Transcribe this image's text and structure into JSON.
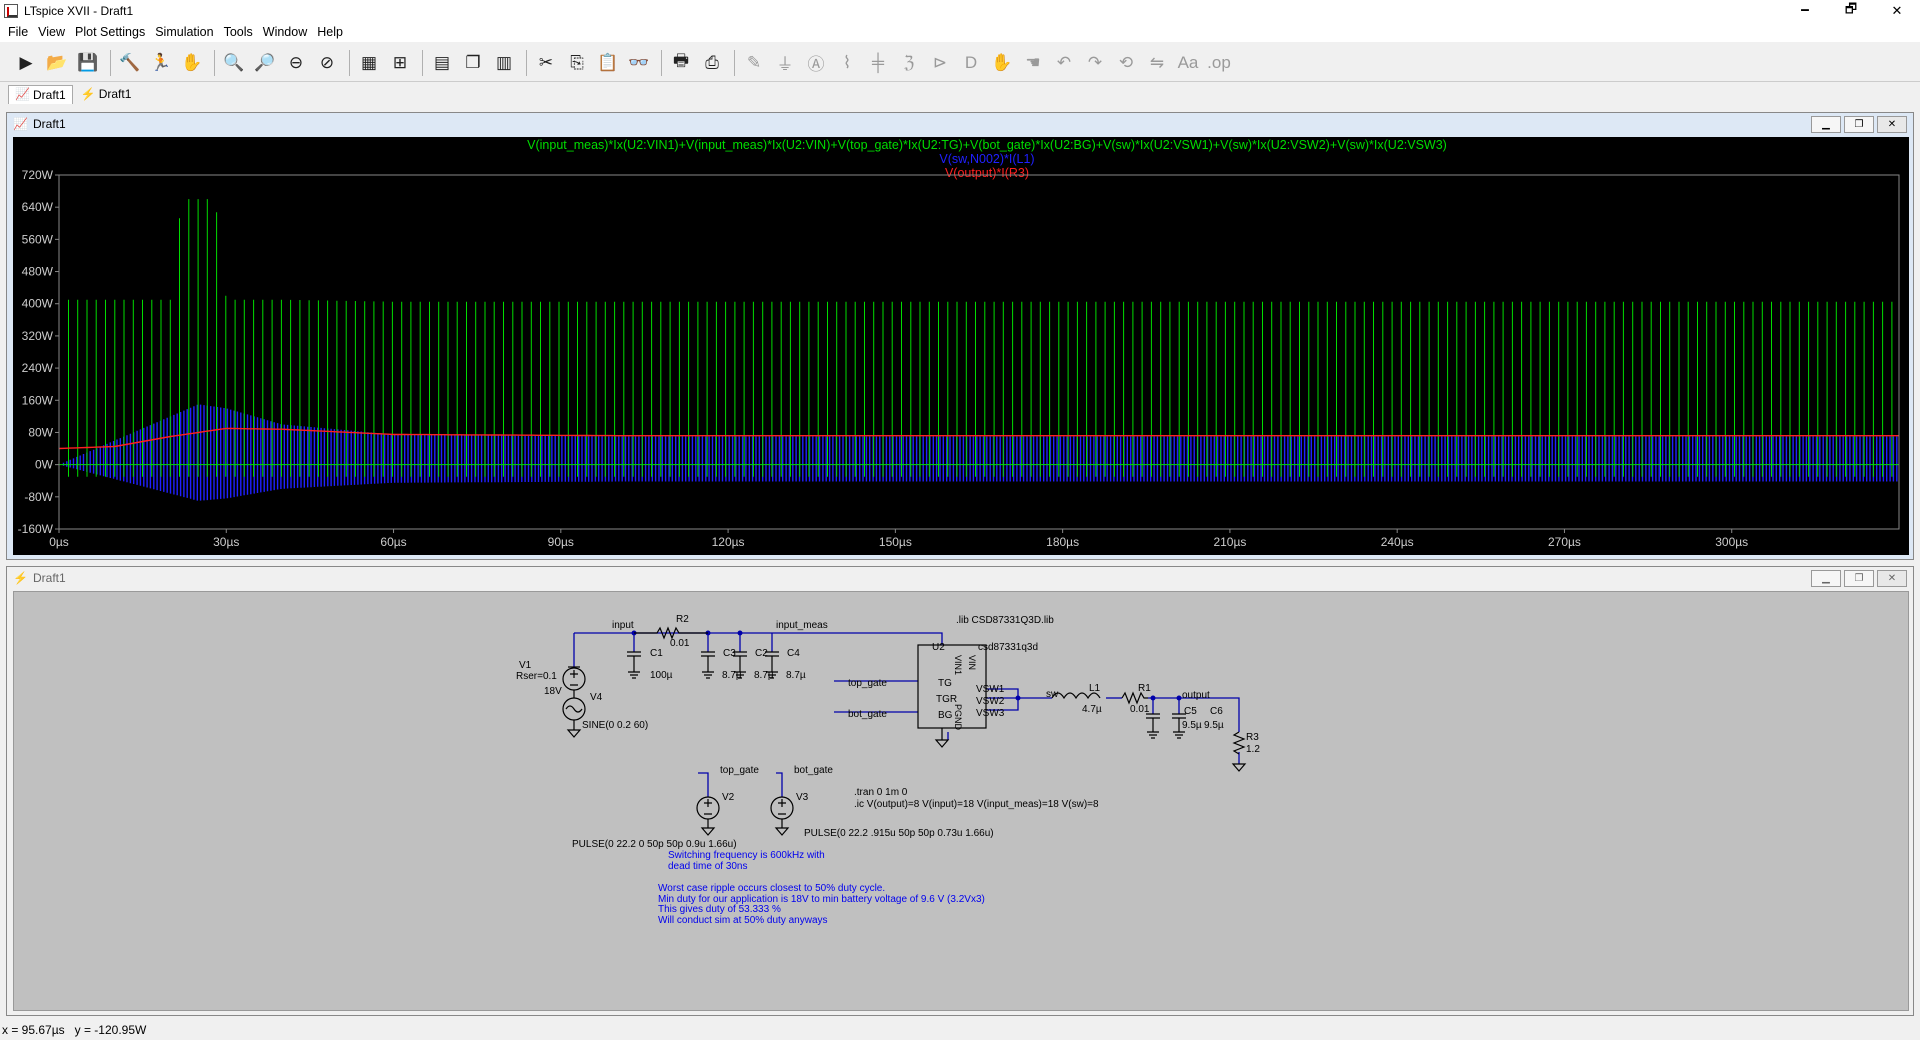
{
  "window": {
    "title": "LTspice XVII - Draft1",
    "min": "🗕",
    "max": "🗗",
    "close": "✕"
  },
  "menu": [
    "File",
    "View",
    "Plot Settings",
    "Simulation",
    "Tools",
    "Window",
    "Help"
  ],
  "toolbar": {
    "icons": [
      "open-schematic-icon",
      "open-file-icon",
      "save-icon",
      "control-panel-icon",
      "run-icon",
      "halt-icon",
      "zoom-in-icon",
      "zoom-out-icon",
      "zoom-fit-icon",
      "zoom-cancel-icon",
      "autorange-icon",
      "mark-icon",
      "tile-horizontal-icon",
      "cascade-icon",
      "tile-vertical-icon",
      "cut-icon",
      "copy-icon",
      "paste-icon",
      "find-icon",
      "print-icon",
      "print-setup-icon",
      "wire-icon",
      "ground-icon",
      "label-icon",
      "resistor-icon",
      "capacitor-icon",
      "inductor-icon",
      "diode-icon",
      "component-icon",
      "move-icon",
      "drag-icon",
      "undo-icon",
      "redo-icon",
      "rotate-icon",
      "mirror-icon",
      "text-icon",
      "spice-directive-icon"
    ]
  },
  "tabs": [
    {
      "label": "Draft1",
      "icon": "waveform-icon"
    },
    {
      "label": "Draft1",
      "icon": "schematic-icon"
    }
  ],
  "plot_window": {
    "title": "Draft1"
  },
  "schematic_window": {
    "title": "Draft1"
  },
  "plot": {
    "traces": [
      {
        "label": "V(input_meas)*Ix(U2:VIN1)+V(input_meas)*Ix(U2:VIN)+V(top_gate)*Ix(U2:TG)+V(bot_gate)*Ix(U2:BG)+V(sw)*Ix(U2:VSW1)+V(sw)*Ix(U2:VSW2)+V(sw)*Ix(U2:VSW3)",
        "color": "#00dd00"
      },
      {
        "label": "V(sw,N002)*I(L1)",
        "color": "#2020ff"
      },
      {
        "label": "V(output)*I(R3)",
        "color": "#ff2020"
      }
    ],
    "y_ticks": [
      "720W",
      "640W",
      "560W",
      "480W",
      "400W",
      "320W",
      "240W",
      "160W",
      "80W",
      "0W",
      "-80W",
      "-160W"
    ],
    "x_ticks": [
      "0µs",
      "30µs",
      "60µs",
      "90µs",
      "120µs",
      "150µs",
      "180µs",
      "210µs",
      "240µs",
      "270µs",
      "300µs"
    ]
  },
  "chart_data": {
    "type": "line",
    "xlabel": "",
    "ylabel": "",
    "xlim": [
      0,
      330
    ],
    "ylim": [
      -160,
      720
    ],
    "x_unit": "µs",
    "y_unit": "W",
    "series": [
      {
        "name": "V(input_meas)*Ix(U2:VIN1)+V(input_meas)*Ix(U2:VIN)+V(top_gate)*Ix(U2:TG)+V(bot_gate)*Ix(U2:BG)+V(sw)*Ix(U2:VSW1)+V(sw)*Ix(U2:VSW2)+V(sw)*Ix(U2:VSW3)",
        "color": "#00dd00",
        "x": [
          0,
          1.7,
          20,
          22,
          28,
          30,
          40,
          60,
          330
        ],
        "y": [
          0,
          410,
          410,
          660,
          660,
          410,
          410,
          405,
          405
        ]
      },
      {
        "name": "V(sw,N002)*I(L1)",
        "color": "#2020ff",
        "x": [
          0,
          10,
          20,
          25,
          30,
          40,
          60,
          100,
          330
        ],
        "y": [
          0,
          60,
          120,
          150,
          140,
          100,
          75,
          70,
          70
        ]
      },
      {
        "name": "V(output)*I(R3)",
        "color": "#ff2020",
        "x": [
          0,
          10,
          20,
          30,
          40,
          60,
          100,
          330
        ],
        "y": [
          40,
          45,
          70,
          90,
          88,
          75,
          72,
          72
        ]
      }
    ]
  },
  "schematic": {
    "labels": {
      "input": "input",
      "input_meas": "input_meas",
      "R2": "R2",
      "R2v": "0.01",
      "C1": "C1",
      "C1v": "100µ",
      "C3": "C3",
      "C3v": "8.7µ",
      "C2": "C2",
      "C2v": "8.7µ",
      "C4": "C4",
      "C4v": "8.7µ",
      "V1": "V1",
      "V1r": "Rser=0.1",
      "V1v": "18V",
      "V4": "V4",
      "V4v": "SINE(0 0.2 60)",
      "lib": ".lib CSD87331Q3D.lib",
      "U2": "U2",
      "U2m": "csd87331q3d",
      "VIN1": "VIN1",
      "VIN": "VIN",
      "TG": "TG",
      "TGR": "TGR",
      "BG": "BG",
      "PGND": "PGND",
      "VSW1": "VSW1",
      "VSW2": "VSW2",
      "VSW3": "VSW3",
      "top_gate": "top_gate",
      "bot_gate": "bot_gate",
      "sw": "sw",
      "L1": "L1",
      "L1v": "4.7µ",
      "R1": "R1",
      "R1v": "0.01",
      "output": "output",
      "C5": "C5",
      "C5v": "9.5µ",
      "C6": "C6",
      "C6v": "9.5µ",
      "R3": "R3",
      "R3v": "1.2",
      "V2": "V2",
      "V3": "V3",
      "top_gate2": "top_gate",
      "bot_gate2": "bot_gate",
      "V2v": "PULSE(0 22.2 0 50p 50p 0.9u 1.66u)",
      "V3v": "PULSE(0 22.2 .915u 50p 50p 0.73u 1.66u)",
      "tran": ".tran 0 1m 0",
      "ic": ".ic V(output)=8 V(input)=18 V(input_meas)=18 V(sw)=8"
    },
    "comments": [
      "Switching frequency is 600kHz with",
      "dead time of 30ns",
      "Worst case ripple occurs closest to 50% duty cycle.",
      "Min duty for our application is 18V to min battery voltage of 9.6 V (3.2Vx3)",
      "This gives duty of 53.333 %",
      "Will conduct sim at 50% duty anyways"
    ]
  },
  "status": {
    "x": "x = 95.67µs",
    "y": "y = -120.95W"
  }
}
